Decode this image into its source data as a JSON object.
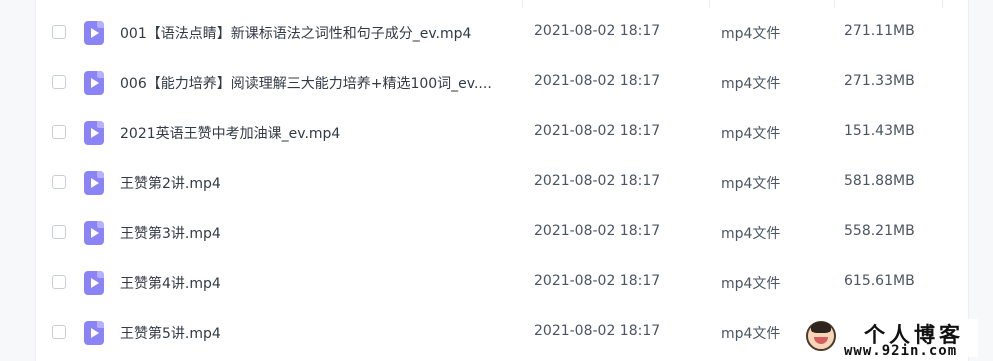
{
  "rows": [
    {
      "name": "001【语法点睛】新课标语法之词性和句子成分_ev.mp4",
      "date": "2021-08-02 18:17",
      "type": "mp4文件",
      "size": "271.11MB",
      "icon": "video-file-icon"
    },
    {
      "name": "006【能力培养】阅读理解三大能力培养+精选100词_ev....",
      "date": "2021-08-02 18:17",
      "type": "mp4文件",
      "size": "271.33MB",
      "icon": "video-file-icon"
    },
    {
      "name": "2021英语王赞中考加油课_ev.mp4",
      "date": "2021-08-02 18:17",
      "type": "mp4文件",
      "size": "151.43MB",
      "icon": "video-file-icon"
    },
    {
      "name": "王赞第2讲.mp4",
      "date": "2021-08-02 18:17",
      "type": "mp4文件",
      "size": "581.88MB",
      "icon": "video-file-icon"
    },
    {
      "name": "王赞第3讲.mp4",
      "date": "2021-08-02 18:17",
      "type": "mp4文件",
      "size": "558.21MB",
      "icon": "video-file-icon"
    },
    {
      "name": "王赞第4讲.mp4",
      "date": "2021-08-02 18:17",
      "type": "mp4文件",
      "size": "615.61MB",
      "icon": "video-file-icon"
    },
    {
      "name": "王赞第5讲.mp4",
      "date": "2021-08-02 18:17",
      "type": "mp4文件",
      "size": "",
      "icon": "video-file-icon"
    }
  ],
  "watermark": {
    "title": "个人博客",
    "url": "www.92in.com",
    "icon": "cartoon-avatar-icon"
  },
  "colors": {
    "file_icon": "#8b84f7",
    "text": "#333a45",
    "checkbox_border": "#c8cdd6",
    "gutter": "#f7f8fa"
  }
}
